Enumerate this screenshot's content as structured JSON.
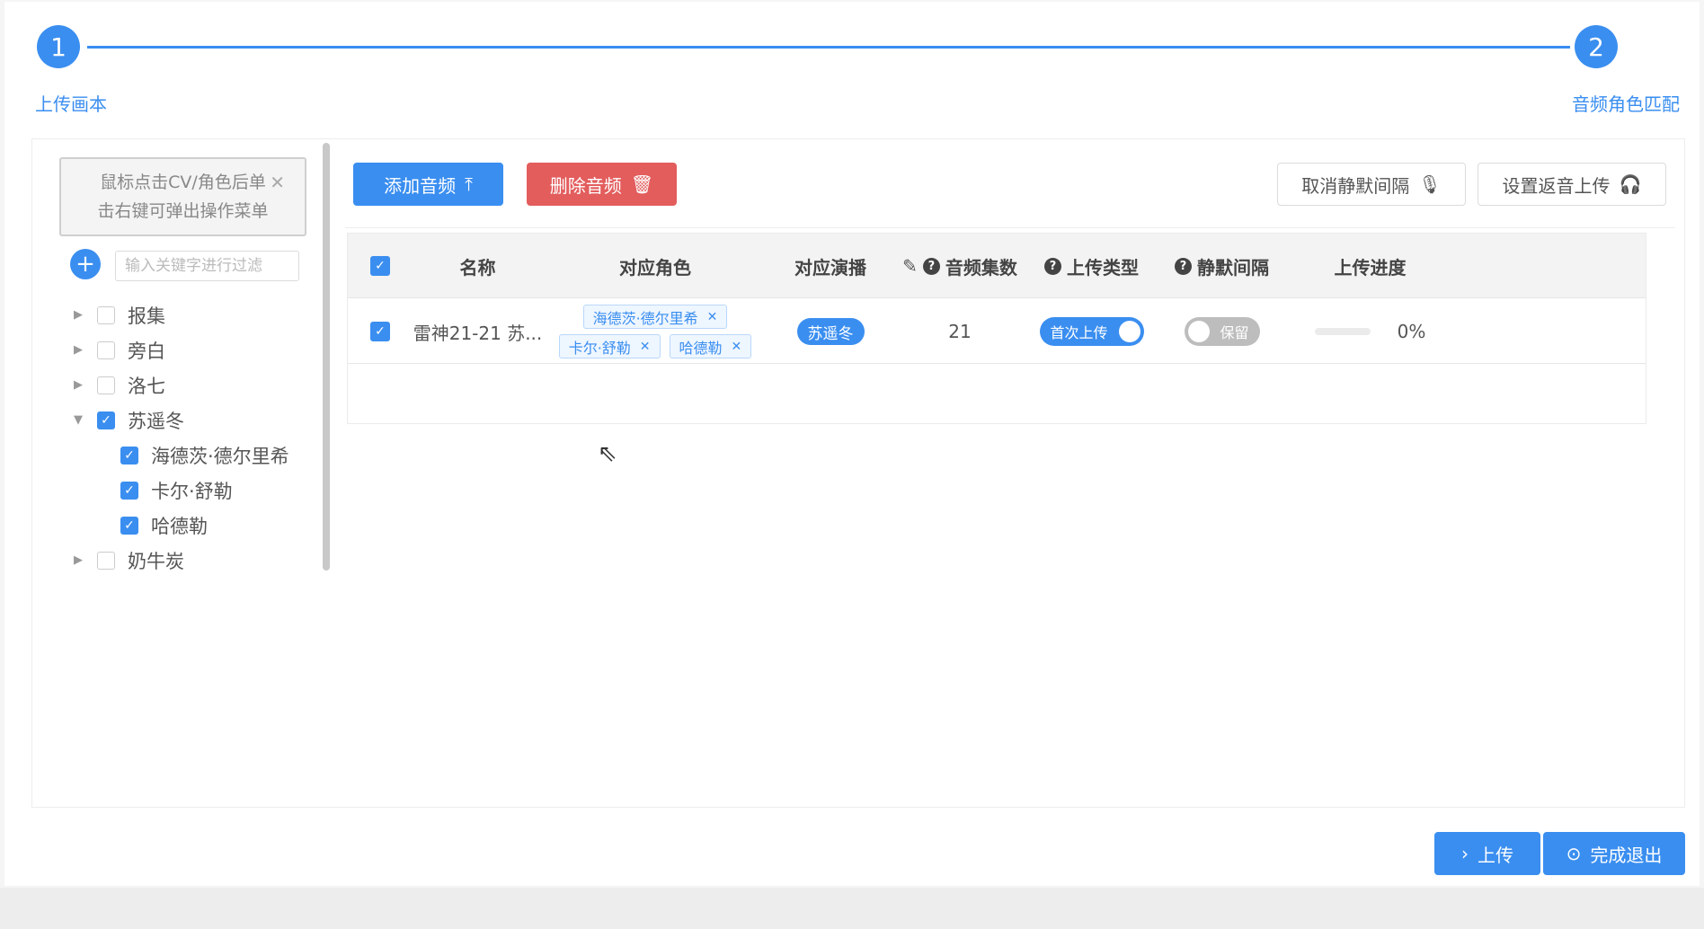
{
  "steps": [
    {
      "number": "1",
      "label": "上传画本"
    },
    {
      "number": "2",
      "label": "音频角色匹配"
    }
  ],
  "sidebar": {
    "hint_line1": "鼠标点击CV/角色后单",
    "hint_line2": "击右键可弹出操作菜单",
    "filter_placeholder": "输入关键字进行过滤",
    "tree": [
      {
        "label": "报集",
        "checked": false,
        "expanded": false
      },
      {
        "label": "旁白",
        "checked": false,
        "expanded": false
      },
      {
        "label": "洛七",
        "checked": false,
        "expanded": false
      },
      {
        "label": "苏遥冬",
        "checked": true,
        "expanded": true
      },
      {
        "label": "海德茨·德尔里希",
        "checked": true,
        "child": true
      },
      {
        "label": "卡尔·舒勒",
        "checked": true,
        "child": true
      },
      {
        "label": "哈德勒",
        "checked": true,
        "child": true
      },
      {
        "label": "奶牛炭",
        "checked": false,
        "expanded": false
      }
    ]
  },
  "toolbar": {
    "add_audio": "添加音频",
    "delete_audio": "删除音频",
    "cancel_silence": "取消静默间隔",
    "set_return_upload": "设置返音上传"
  },
  "table": {
    "headers": {
      "name": "名称",
      "role": "对应角色",
      "performer": "对应演播",
      "episodes": "音频集数",
      "upload_type": "上传类型",
      "silence": "静默间隔",
      "progress": "上传进度"
    },
    "rows": [
      {
        "name": "雷神21-21 苏...",
        "roles": [
          "海德茨·德尔里希",
          "卡尔·舒勒",
          "哈德勒"
        ],
        "performer": "苏遥冬",
        "episodes": "21",
        "upload_type": "首次上传",
        "silence": "保留",
        "progress_text": "0%",
        "progress_value": 0
      }
    ]
  },
  "footer": {
    "upload": "上传",
    "finish": "完成退出"
  },
  "colors": {
    "primary": "#3a8ef0",
    "danger": "#e35d5d"
  }
}
